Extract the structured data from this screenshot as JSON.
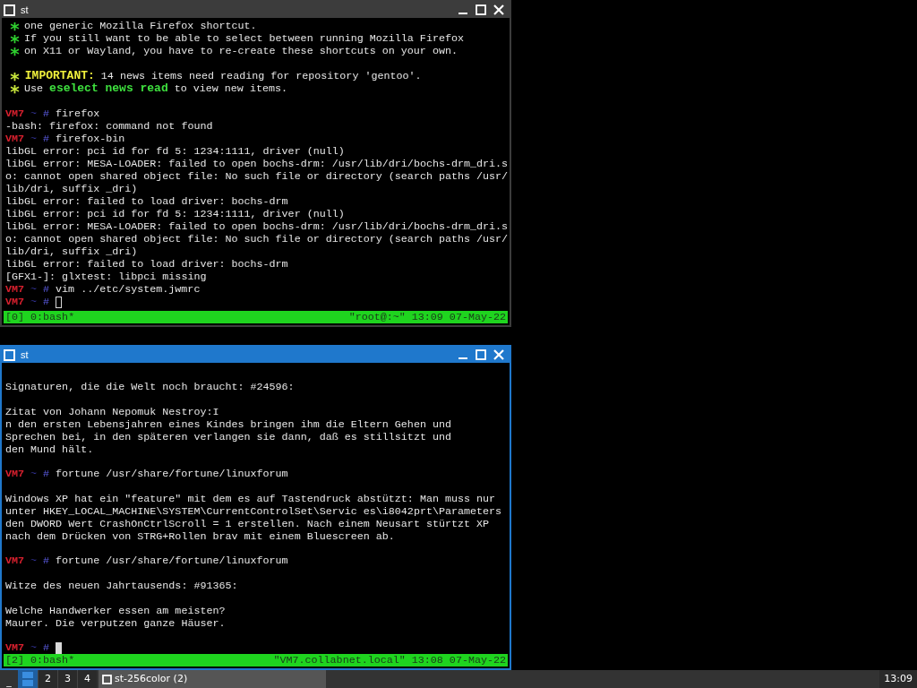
{
  "windows": [
    {
      "title": "st",
      "focused": false,
      "lines": [
        {
          "kind": "rich",
          "segments": [
            {
              "kind": "bullet",
              "text": "*",
              "color": "#2fd02f",
              "bold": true
            },
            {
              "text": " one generic Mozilla Firefox shortcut."
            }
          ]
        },
        {
          "kind": "rich",
          "segments": [
            {
              "kind": "bullet",
              "text": "*",
              "color": "#2fd02f",
              "bold": true
            },
            {
              "text": " If you still want to be able to select between running Mozilla Firefox"
            }
          ]
        },
        {
          "kind": "rich",
          "segments": [
            {
              "kind": "bullet",
              "text": "*",
              "color": "#2fd02f",
              "bold": true
            },
            {
              "text": " on X11 or Wayland, you have to re-create these shortcuts on your own."
            }
          ]
        },
        {
          "kind": "blank"
        },
        {
          "kind": "rich",
          "segments": [
            {
              "kind": "bullet",
              "text": "*",
              "color": "#c8e63c",
              "bold": true
            },
            {
              "text": " IMPORTANT:",
              "color": "#f0f03c",
              "bold": true
            },
            {
              "text": " 14 news items need reading for repository 'gentoo'."
            }
          ]
        },
        {
          "kind": "rich",
          "segments": [
            {
              "kind": "bullet",
              "text": "*",
              "color": "#c8e63c",
              "bold": true
            },
            {
              "text": " Use "
            },
            {
              "text": "eselect news read",
              "color": "#3ee03e",
              "bold": true
            },
            {
              "text": " to view new items."
            }
          ]
        },
        {
          "kind": "blank"
        },
        {
          "kind": "prompt",
          "host": "VM7",
          "dir": "~",
          "sign": "#",
          "command": "firefox"
        },
        {
          "kind": "text",
          "text": "-bash: firefox: command not found"
        },
        {
          "kind": "prompt",
          "host": "VM7",
          "dir": "~",
          "sign": "#",
          "command": "firefox-bin"
        },
        {
          "kind": "text",
          "text": "libGL error: pci id for fd 5: 1234:1111, driver (null)"
        },
        {
          "kind": "text",
          "text": "libGL error: MESA-LOADER: failed to open bochs-drm: /usr/lib/dri/bochs-drm_dri.s"
        },
        {
          "kind": "text",
          "text": "o: cannot open shared object file: No such file or directory (search paths /usr/"
        },
        {
          "kind": "text",
          "text": "lib/dri, suffix _dri)"
        },
        {
          "kind": "text",
          "text": "libGL error: failed to load driver: bochs-drm"
        },
        {
          "kind": "text",
          "text": "libGL error: pci id for fd 5: 1234:1111, driver (null)"
        },
        {
          "kind": "text",
          "text": "libGL error: MESA-LOADER: failed to open bochs-drm: /usr/lib/dri/bochs-drm_dri.s"
        },
        {
          "kind": "text",
          "text": "o: cannot open shared object file: No such file or directory (search paths /usr/"
        },
        {
          "kind": "text",
          "text": "lib/dri, suffix _dri)"
        },
        {
          "kind": "text",
          "text": "libGL error: failed to load driver: bochs-drm"
        },
        {
          "kind": "text",
          "text": "[GFX1-]: glxtest: libpci missing"
        },
        {
          "kind": "prompt",
          "host": "VM7",
          "dir": "~",
          "sign": "#",
          "command": "vim ../etc/system.jwmrc"
        },
        {
          "kind": "prompt",
          "host": "VM7",
          "dir": "~",
          "sign": "#",
          "cursor": true
        }
      ],
      "status_bar": {
        "left": "[0] 0:bash*",
        "right": "\"root@:~\" 13:09 07-May-22"
      }
    },
    {
      "title": "st",
      "focused": true,
      "lines": [
        {
          "kind": "blank"
        },
        {
          "kind": "text",
          "text": "Signaturen, die die Welt noch braucht: #24596:"
        },
        {
          "kind": "blank"
        },
        {
          "kind": "text",
          "text": "Zitat von Johann Nepomuk Nestroy:I"
        },
        {
          "kind": "text",
          "text": "n den ersten Lebensjahren eines Kindes bringen ihm die Eltern Gehen und"
        },
        {
          "kind": "text",
          "text": "Sprechen bei, in den späteren verlangen sie dann, daß es stillsitzt und"
        },
        {
          "kind": "text",
          "text": "den Mund hält."
        },
        {
          "kind": "blank"
        },
        {
          "kind": "prompt",
          "host": "VM7",
          "dir": "~",
          "sign": "#",
          "command": "fortune /usr/share/fortune/linuxforum"
        },
        {
          "kind": "blank"
        },
        {
          "kind": "text",
          "text": "Windows XP hat ein \"feature\" mit dem es auf Tastendruck abstützt: Man muss nur"
        },
        {
          "kind": "text",
          "text": "unter HKEY_LOCAL_MACHINE\\SYSTEM\\CurrentControlSet\\Servic es\\i8042prt\\Parameters"
        },
        {
          "kind": "text",
          "text": "den DWORD Wert CrashOnCtrlScroll = 1 erstellen. Nach einem Neusart stürtzt XP"
        },
        {
          "kind": "text",
          "text": "nach dem Drücken von STRG+Rollen brav mit einem Bluescreen ab."
        },
        {
          "kind": "blank"
        },
        {
          "kind": "prompt",
          "host": "VM7",
          "dir": "~",
          "sign": "#",
          "command": "fortune /usr/share/fortune/linuxforum"
        },
        {
          "kind": "blank"
        },
        {
          "kind": "text",
          "text": "Witze des neuen Jahrtausends: #91365:"
        },
        {
          "kind": "blank"
        },
        {
          "kind": "text",
          "text": "Welche Handwerker essen am meisten?"
        },
        {
          "kind": "text",
          "text": "Maurer. Die verputzen ganze Häuser."
        },
        {
          "kind": "blank"
        },
        {
          "kind": "prompt",
          "host": "VM7",
          "dir": "~",
          "sign": "#",
          "cursor": true
        }
      ],
      "status_bar": {
        "left": "[2] 0:bash*",
        "right": "\"VM7.collabnet.local\" 13:08 07-May-22"
      }
    }
  ],
  "taskbar": {
    "minimize": "_",
    "workspaces": [
      {
        "selected": true
      },
      {
        "label": "2",
        "selected": false
      },
      {
        "label": "3",
        "selected": false
      },
      {
        "label": "4",
        "selected": false
      }
    ],
    "task": {
      "label": "st-256color (2)"
    },
    "clock": "13:09"
  }
}
